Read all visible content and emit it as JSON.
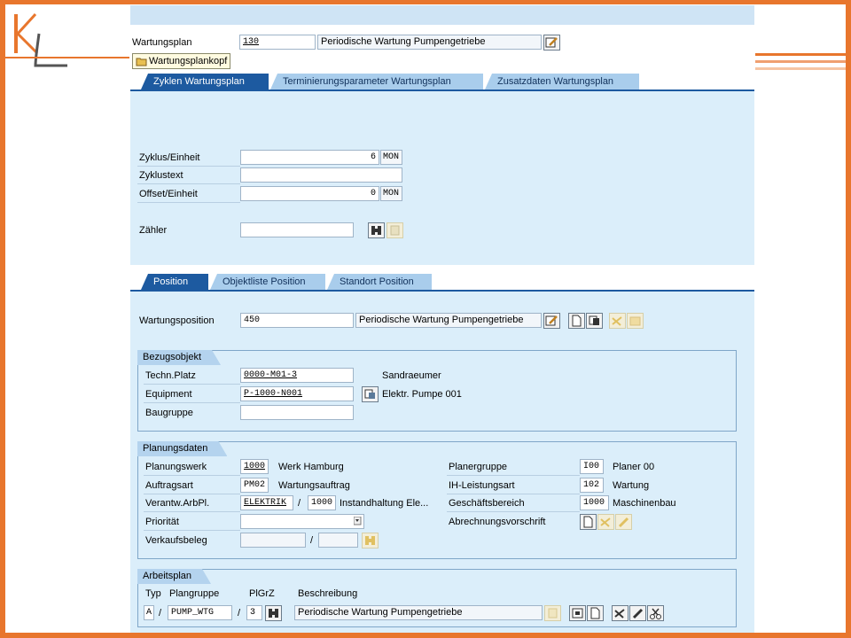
{
  "header": {
    "wartungsplan_label": "Wartungsplan",
    "wartungsplan_value": "130",
    "wartungsplan_text": "Periodische Wartung Pumpengetriebe",
    "kopf_button": "Wartungsplankopf"
  },
  "tabs_top": [
    "Zyklen Wartungsplan",
    "Terminierungsparameter Wartungsplan",
    "Zusatzdaten  Wartungsplan"
  ],
  "zyklen": {
    "zyklus_label": "Zyklus/Einheit",
    "zyklus_value": "6",
    "zyklus_unit": "MON",
    "zyklustext_label": "Zyklustext",
    "zyklustext_value": "",
    "offset_label": "Offset/Einheit",
    "offset_value": "0",
    "offset_unit": "MON",
    "zaehler_label": "Zähler",
    "zaehler_value": ""
  },
  "tabs_position": [
    "Position",
    "Objektliste Position",
    "Standort Position"
  ],
  "position": {
    "label": "Wartungsposition",
    "value": "450",
    "text": "Periodische Wartung Pumpengetriebe"
  },
  "bezugsobjekt": {
    "title": "Bezugsobjekt",
    "techn_platz_label": "Techn.Platz",
    "techn_platz_value": "0000-M01-3",
    "techn_platz_text": "Sandraeumer",
    "equipment_label": "Equipment",
    "equipment_value": "P-1000-N001",
    "equipment_text": "Elektr. Pumpe 001",
    "baugruppe_label": "Baugruppe",
    "baugruppe_value": ""
  },
  "planungsdaten": {
    "title": "Planungsdaten",
    "planungswerk_label": "Planungswerk",
    "planungswerk_value": "1000",
    "planungswerk_text": "Werk Hamburg",
    "auftragsart_label": "Auftragsart",
    "auftragsart_value": "PM02",
    "auftragsart_text": "Wartungsauftrag",
    "arbpl_label": "Verantw.ArbPl.",
    "arbpl_value": "ELEKTRIK",
    "arbpl_sep": "/",
    "arbpl_werk": "1000",
    "arbpl_text": "Instandhaltung Ele...",
    "prioritaet_label": "Priorität",
    "prioritaet_value": "",
    "verkaufsbeleg_label": "Verkaufsbeleg",
    "verkaufsbeleg_value": "",
    "verkaufsbeleg_sep": "/",
    "verkaufsbeleg_pos": "",
    "planergruppe_label": "Planergruppe",
    "planergruppe_value": "I00",
    "planergruppe_text": "Planer 00",
    "ih_label": "IH-Leistungsart",
    "ih_value": "102",
    "ih_text": "Wartung",
    "gb_label": "Geschäftsbereich",
    "gb_value": "1000",
    "gb_text": "Maschinenbau",
    "abrechnung_label": "Abrechnungsvorschrift"
  },
  "arbeitsplan": {
    "title": "Arbeitsplan",
    "col_typ": "Typ",
    "col_plangruppe": "Plangruppe",
    "col_plgrz": "PlGrZ",
    "col_beschreibung": "Beschreibung",
    "typ_value": "A",
    "sep1": "/",
    "plangruppe_value": "PUMP_WTG",
    "sep2": "/",
    "plgrz_value": "3",
    "beschreibung_value": "Periodische Wartung Pumpengetriebe"
  },
  "colors": {
    "frame": "#e8762d",
    "tab_active": "#1d5aa0",
    "tab_inactive": "#a9cdec",
    "panel": "#dbeefa"
  },
  "icons": [
    "edit-icon",
    "search-icon",
    "create-icon",
    "display-icon",
    "copy-icon",
    "change-icon",
    "delete-icon",
    "cut-icon"
  ]
}
